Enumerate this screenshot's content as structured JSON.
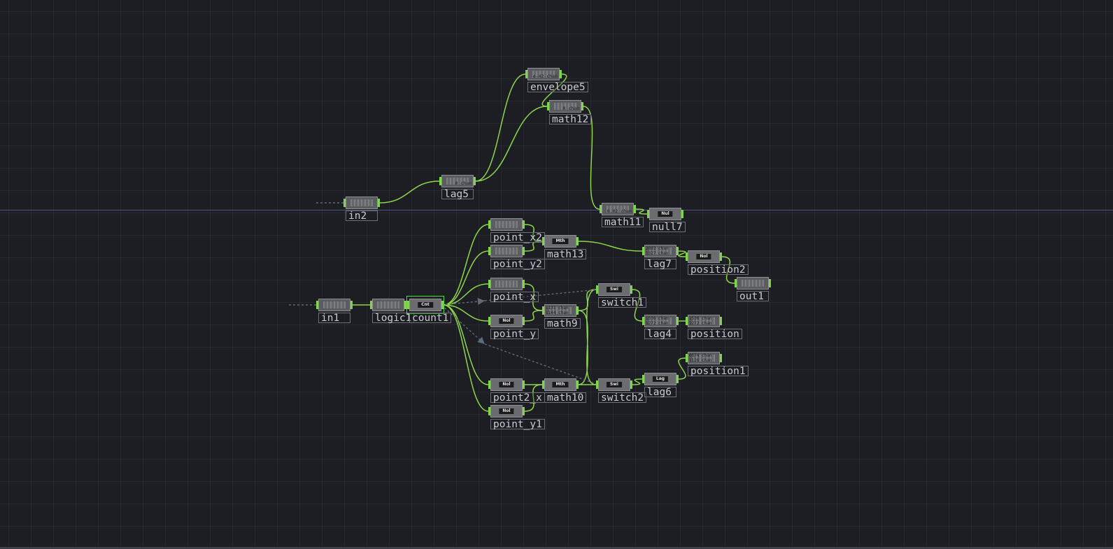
{
  "network": {
    "nodes": [
      {
        "id": "envelope5",
        "label": "envelope5",
        "type": "viewer",
        "chan": "e-42 chan"
      },
      {
        "id": "math12",
        "label": "math12",
        "type": "viewer",
        "chan": "0 chan"
      },
      {
        "id": "lag5",
        "label": "lag5",
        "type": "viewer",
        "chan": "0 chan"
      },
      {
        "id": "in2",
        "label": "in2",
        "type": "viewer",
        "chan": ""
      },
      {
        "id": "math11",
        "label": "math11",
        "type": "viewer",
        "chan": "0.02 chan"
      },
      {
        "id": "null7",
        "label": "null7",
        "type": "badge",
        "badge": "Nul"
      },
      {
        "id": "point_x2",
        "label": "point_x2",
        "type": "viewer",
        "chan": ""
      },
      {
        "id": "point_y2",
        "label": "point_y2",
        "type": "viewer",
        "chan": ""
      },
      {
        "id": "math13",
        "label": "math13",
        "type": "badge",
        "badge": "Mth"
      },
      {
        "id": "lag7",
        "label": "lag7",
        "type": "viewer",
        "chan": "2892 chan\n1327 chan"
      },
      {
        "id": "position2",
        "label": "position2",
        "type": "badge",
        "badge": "Nol"
      },
      {
        "id": "out1",
        "label": "out1",
        "type": "viewer",
        "chan": ""
      },
      {
        "id": "in1",
        "label": "in1",
        "type": "viewer",
        "chan": ""
      },
      {
        "id": "logic1",
        "label": "logic1",
        "type": "viewer",
        "chan": ""
      },
      {
        "id": "count1",
        "label": "count1",
        "type": "badge",
        "badge": "Cnt"
      },
      {
        "id": "point_x",
        "label": "point_x",
        "type": "viewer",
        "chan": ""
      },
      {
        "id": "point_y",
        "label": "point_y",
        "type": "badge",
        "badge": "Nol"
      },
      {
        "id": "math9",
        "label": "math9",
        "type": "viewer",
        "chan": "1131 chan\n1144 chan"
      },
      {
        "id": "switch1",
        "label": "switch1",
        "type": "badge",
        "badge": "Swi"
      },
      {
        "id": "lag4",
        "label": "lag4",
        "type": "viewer",
        "chan": "1536 chan\n1272 chan"
      },
      {
        "id": "position",
        "label": "position",
        "type": "viewer",
        "chan": "1536 chan\n1272 chan"
      },
      {
        "id": "position1",
        "label": "position1",
        "type": "viewer",
        "chan": "0674 chan\n1126 chan"
      },
      {
        "id": "point2_x",
        "label": "point2_x",
        "type": "badge",
        "badge": "Nol"
      },
      {
        "id": "math10",
        "label": "math10",
        "type": "badge",
        "badge": "Mth"
      },
      {
        "id": "switch2",
        "label": "switch2",
        "type": "badge",
        "badge": "Swi"
      },
      {
        "id": "lag6",
        "label": "lag6",
        "type": "badge",
        "badge": "Lag"
      },
      {
        "id": "point_y1",
        "label": "point_y1",
        "type": "badge",
        "badge": "Nol"
      }
    ],
    "selected": "count1",
    "colors": {
      "wire": "#8fd649",
      "export": "#5f6b78",
      "port": "#7fd64a",
      "selection": "#48e13a",
      "background": "#1c1e24"
    }
  }
}
